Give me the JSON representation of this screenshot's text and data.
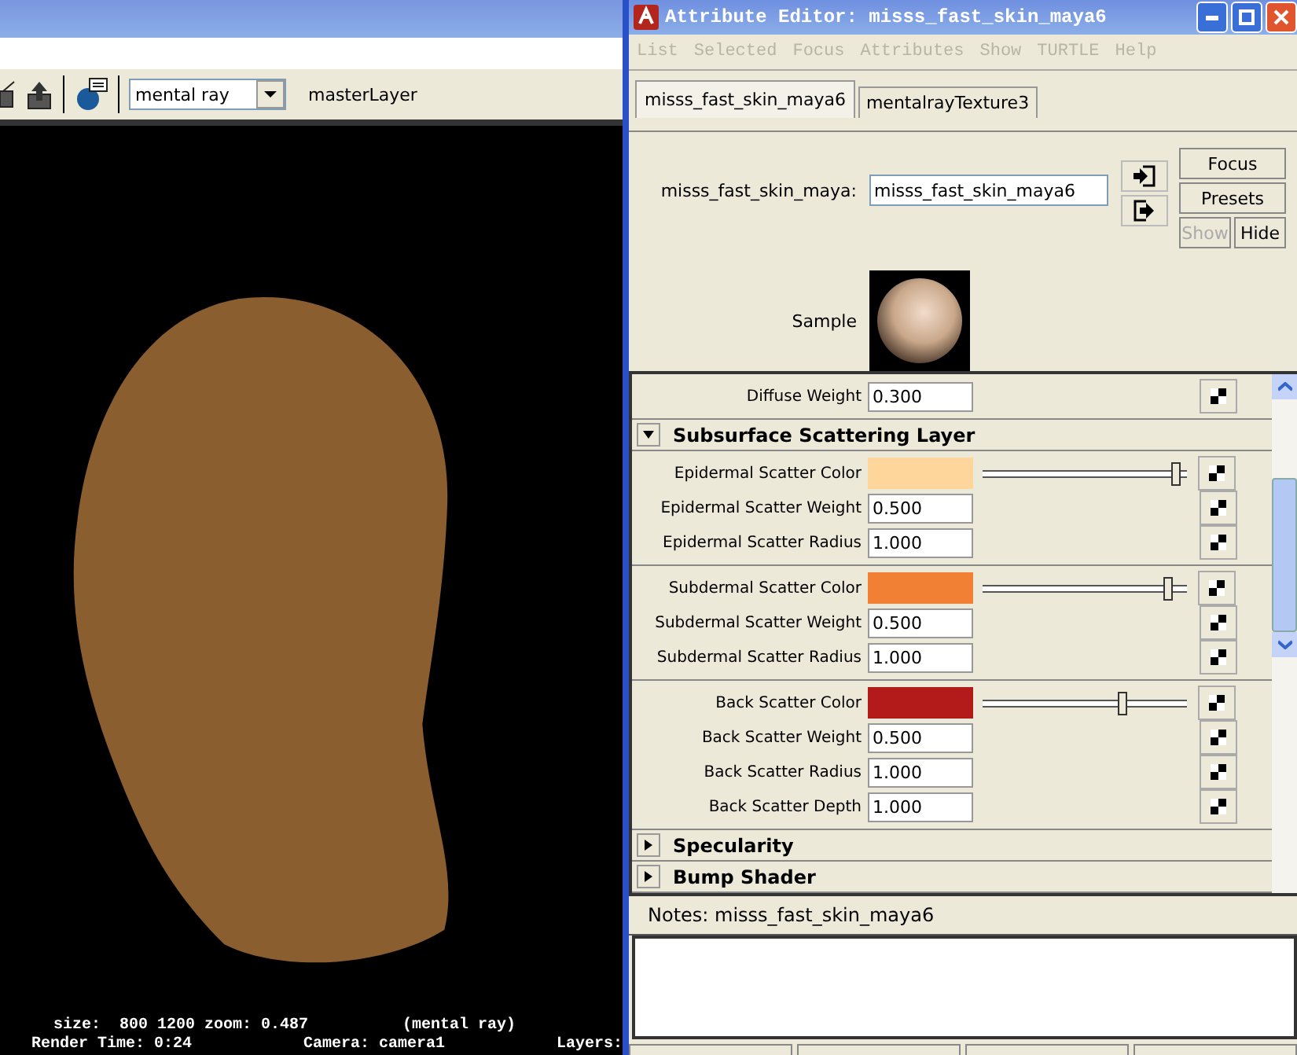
{
  "render_view": {
    "toolbar": {
      "renderer": "mental ray",
      "layer": "masterLayer"
    },
    "status_lines": [
      {
        "parts": [
          "size:  800 1200 zoom: 0.487",
          "(mental ray)"
        ]
      },
      {
        "parts": [
          "Render Time: 0:24",
          "Camera: camera1",
          "Layers:"
        ]
      }
    ]
  },
  "attribute_editor": {
    "title": "Attribute Editor: misss_fast_skin_maya6",
    "menu": [
      {
        "label": "List",
        "disabled": true
      },
      {
        "label": "Selected",
        "disabled": true
      },
      {
        "label": "Focus",
        "disabled": true
      },
      {
        "label": "Attributes",
        "disabled": true
      },
      {
        "label": "Show",
        "disabled": true
      },
      {
        "label": "TURTLE",
        "disabled": true
      },
      {
        "label": "Help",
        "disabled": true
      }
    ],
    "tabs": [
      {
        "label": "misss_fast_skin_maya6",
        "selected": true
      },
      {
        "label": "mentalrayTexture3",
        "selected": false
      }
    ],
    "node": {
      "label": "misss_fast_skin_maya:",
      "value": "misss_fast_skin_maya6"
    },
    "buttons": [
      {
        "label": "Focus",
        "disabled": false
      },
      {
        "label": "Presets",
        "disabled": false
      },
      {
        "label": "Show",
        "disabled": true
      },
      {
        "label": "Hide",
        "disabled": false
      }
    ],
    "sample": {
      "label": "Sample"
    },
    "top_rows": [
      {
        "kind": "number",
        "label": "Diffuse Weight",
        "value": "0.300"
      }
    ],
    "sections": [
      {
        "title": "Subsurface Scattering Layer",
        "expanded": true,
        "groups": [
          {
            "rows": [
              {
                "kind": "color",
                "label": "Epidermal Scatter Color",
                "color": "#fed59a",
                "level": 0.97
              },
              {
                "kind": "number",
                "label": "Epidermal Scatter Weight",
                "value": "0.500"
              },
              {
                "kind": "number",
                "label": "Epidermal Scatter Radius",
                "value": "1.000"
              }
            ]
          },
          {
            "rows": [
              {
                "kind": "color",
                "label": "Subdermal Scatter Color",
                "color": "#f28034",
                "level": 0.93
              },
              {
                "kind": "number",
                "label": "Subdermal Scatter Weight",
                "value": "0.500"
              },
              {
                "kind": "number",
                "label": "Subdermal Scatter Radius",
                "value": "1.000"
              }
            ]
          },
          {
            "rows": [
              {
                "kind": "color",
                "label": "Back Scatter Color",
                "color": "#b31b1b",
                "level": 0.69
              },
              {
                "kind": "number",
                "label": "Back Scatter Weight",
                "value": "0.500"
              },
              {
                "kind": "number",
                "label": "Back Scatter Radius",
                "value": "1.000"
              },
              {
                "kind": "number",
                "label": "Back Scatter Depth",
                "value": "1.000"
              }
            ]
          }
        ]
      },
      {
        "title": "Specularity",
        "expanded": false
      },
      {
        "title": "Bump Shader",
        "expanded": false
      }
    ],
    "notes": {
      "heading": "Notes:  misss_fast_skin_maya6"
    }
  }
}
